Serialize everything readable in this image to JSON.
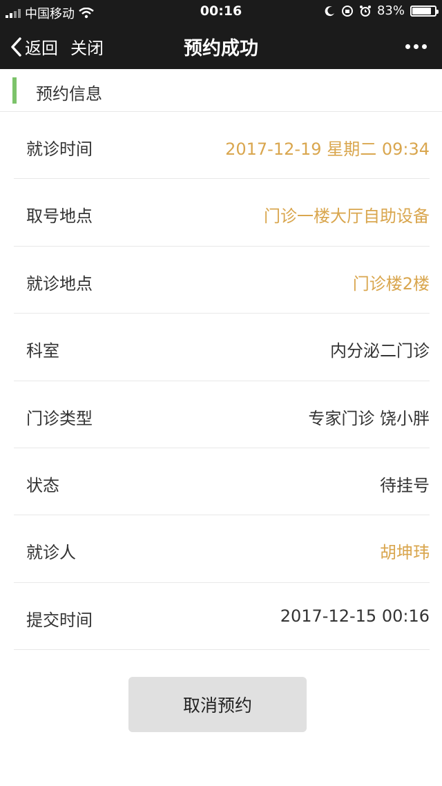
{
  "status_bar": {
    "carrier": "中国移动",
    "time": "00:16",
    "battery_percent": "83%",
    "battery_level": 0.83
  },
  "nav": {
    "back_label": "返回",
    "close_label": "关闭",
    "title": "预约成功"
  },
  "section": {
    "title": "预约信息",
    "accent_color": "#7cc36a"
  },
  "rows": [
    {
      "label": "就诊时间",
      "value": "2017-12-19 星期二 09:34",
      "accent": true
    },
    {
      "label": "取号地点",
      "value": "门诊一楼大厅自助设备",
      "accent": true
    },
    {
      "label": "就诊地点",
      "value": "门诊楼2楼",
      "accent": true
    },
    {
      "label": "科室",
      "value": "内分泌二门诊",
      "accent": false
    },
    {
      "label": "门诊类型",
      "value": "专家门诊 饶小胖",
      "accent": false
    },
    {
      "label": "状态",
      "value": "待挂号",
      "accent": false
    },
    {
      "label": "就诊人",
      "value": "胡坤玮",
      "accent": true
    },
    {
      "label": "提交时间",
      "value": "2017-12-15 00:16",
      "accent": false
    }
  ],
  "colors": {
    "accent_value": "#d9a64e",
    "header_bg": "#1b1b1b"
  },
  "cancel_label": "取消预约"
}
